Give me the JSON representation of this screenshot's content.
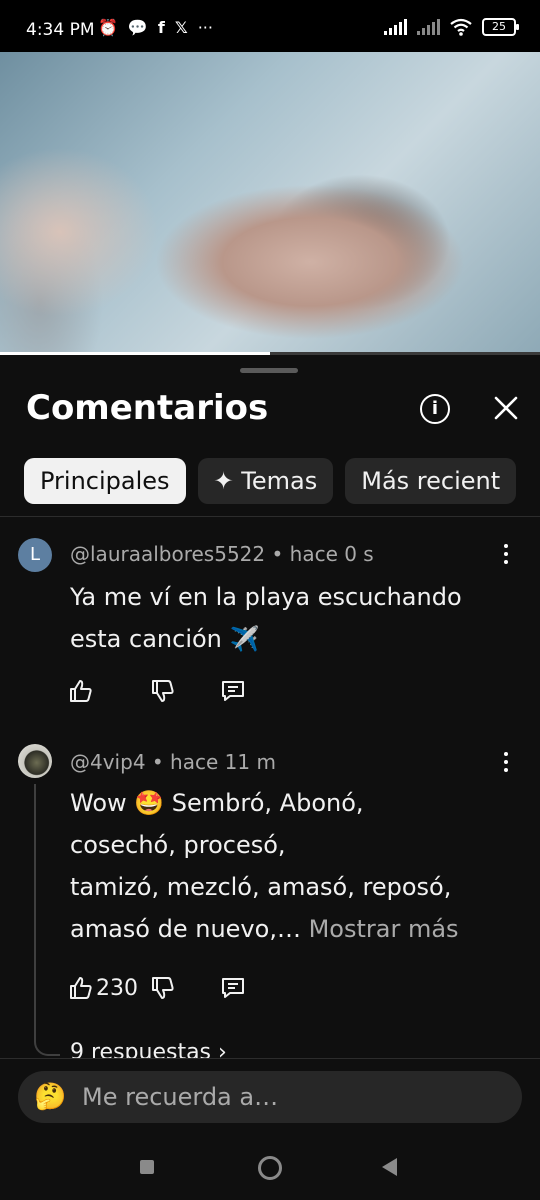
{
  "status_bar": {
    "time": "4:34 PM",
    "icons": [
      "alarm-icon",
      "chat-bubble-icon",
      "facebook-icon",
      "x-icon",
      "more-dots-icon"
    ],
    "overflow": "···",
    "battery": "25"
  },
  "video": {
    "progress": 0.5
  },
  "sheet": {
    "title": "Comentarios",
    "info_icon": "i",
    "close_icon": "close-icon"
  },
  "chips": [
    {
      "label": "Principales",
      "active": true
    },
    {
      "label": "✦ Temas",
      "active": false
    },
    {
      "label": "Más recient",
      "active": false
    }
  ],
  "comments": [
    {
      "avatar_letter": "L",
      "user": "@lauraalbores5522",
      "time": "• hace 0 s",
      "lines": [
        "Ya me ví en la playa escuchando",
        "esta canción ✈️"
      ],
      "likes": ""
    },
    {
      "user": "@4vip4",
      "time": "• hace 11 m",
      "lines": [
        "Wow 🤩 Sembró, Abonó,",
        "cosechó, procesó,",
        "tamizó, mezcló, amasó, reposó,",
        "amasó de nuevo,…"
      ],
      "show_more": "Mostrar más",
      "likes": "230",
      "replies": "9 respuestas ›"
    }
  ],
  "input": {
    "emoji": "🤔",
    "placeholder": "Me recuerda a…"
  },
  "colors": {
    "background": "#0f0f0f",
    "chip_active": "#f1f1f1",
    "chip_inactive": "#272727",
    "secondary_text": "#aaaaaa",
    "avatar_l": "#5d7fa1"
  }
}
